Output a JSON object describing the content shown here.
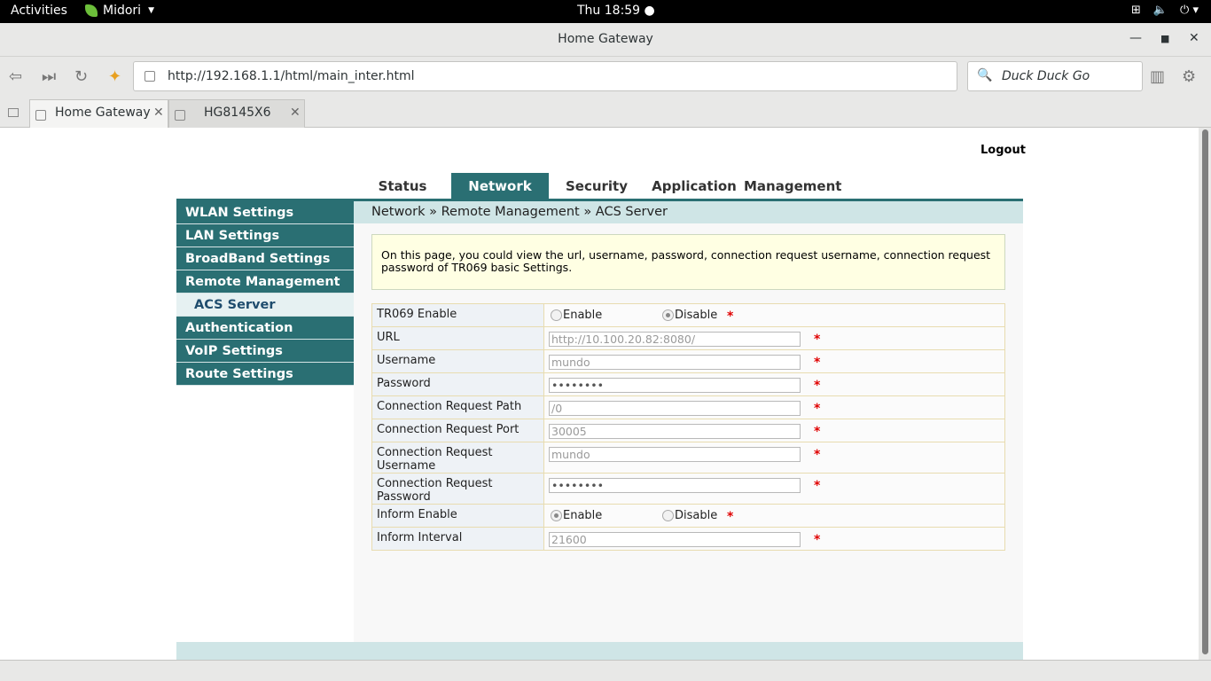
{
  "topbar": {
    "activities": "Activities",
    "app_name": "Midori",
    "clock": "Thu 18:59",
    "tray_icons": [
      "network-icon",
      "volume-icon",
      "power-icon"
    ]
  },
  "window": {
    "title": "Home Gateway"
  },
  "toolbar": {
    "url": "http://192.168.1.1/html/main_inter.html",
    "search_engine": "Duck Duck Go"
  },
  "tabs": [
    {
      "label": "Home Gateway",
      "active": true
    },
    {
      "label": "HG8145X6",
      "active": false
    }
  ],
  "page": {
    "logout_label": "Logout",
    "nav_tabs": [
      "Status",
      "Network",
      "Security",
      "Application",
      "Management"
    ],
    "active_nav": "Network",
    "sidebar_items": [
      "WLAN Settings",
      "LAN Settings",
      "BroadBand Settings",
      "Remote Management",
      "ACS Server",
      "Authentication",
      "VoIP Settings",
      "Route Settings"
    ],
    "breadcrumb": "Network » Remote Management » ACS Server",
    "info_text": "On this page, you could view the url, username, password, connection request username, connection request password of TR069 basic Settings.",
    "form": {
      "tr069_label": "TR069 Enable",
      "enable_label": "Enable",
      "disable_label": "Disable",
      "url_label": "URL",
      "url_value": "http://10.100.20.82:8080/",
      "username_label": "Username",
      "username_value": "mundo",
      "password_label": "Password",
      "password_value": "••••••••",
      "cr_path_label": "Connection Request Path",
      "cr_path_value": "/0",
      "cr_port_label": "Connection Request Port",
      "cr_port_value": "30005",
      "cr_username_label": "Connection Request Username",
      "cr_username_value": "mundo",
      "cr_password_label": "Connection Request Password",
      "cr_password_value": "••••••••",
      "inform_enable_label": "Inform Enable",
      "inform_interval_label": "Inform Interval",
      "inform_interval_value": "21600",
      "required_mark": "*",
      "tr069_selected": "Disable",
      "inform_selected": "Enable"
    }
  },
  "colors": {
    "accent": "#2a6f73",
    "breadcrumb_bg": "#cfe5e6",
    "info_bg": "#ffffe3",
    "required": "#e00000"
  }
}
